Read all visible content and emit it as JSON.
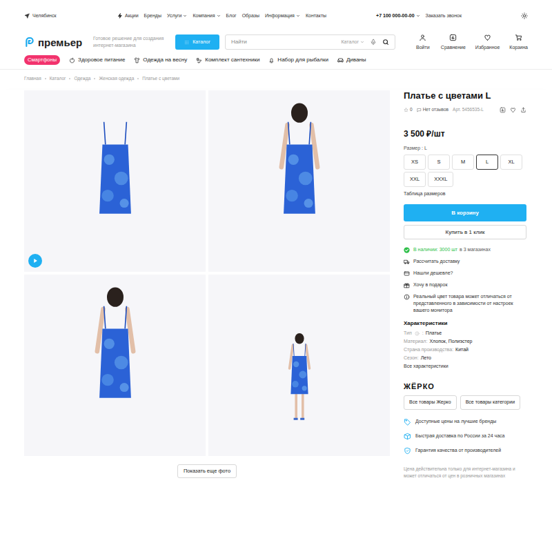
{
  "topbar": {
    "city": "Челябинск",
    "nav": [
      {
        "label": "Акции",
        "dropdown": false
      },
      {
        "label": "Бренды",
        "dropdown": false
      },
      {
        "label": "Услуги",
        "dropdown": true
      },
      {
        "label": "Компания",
        "dropdown": true
      },
      {
        "label": "Блог",
        "dropdown": false
      },
      {
        "label": "Образы",
        "dropdown": false
      },
      {
        "label": "Информация",
        "dropdown": true
      },
      {
        "label": "Контакты",
        "dropdown": false
      }
    ],
    "phone": "+7 100 000-00-00",
    "phone_dropdown": true,
    "callback": "Заказать звонок"
  },
  "header": {
    "logo": "премьер",
    "tagline": "Готовое решение для создания интернет-магазина",
    "catalog_button": "Каталог",
    "search": {
      "placeholder": "Найти",
      "scope": "Каталог"
    },
    "actions": [
      {
        "label": "Войти"
      },
      {
        "label": "Сравнение"
      },
      {
        "label": "Избранное"
      },
      {
        "label": "Корзина"
      }
    ]
  },
  "categories": [
    {
      "label": "Смартфоны",
      "highlighted": true
    },
    {
      "label": "Здоровое питание",
      "highlighted": false
    },
    {
      "label": "Одежда на весну",
      "highlighted": false
    },
    {
      "label": "Комплект сантехники",
      "highlighted": false
    },
    {
      "label": "Набор для рыбалки",
      "highlighted": false
    },
    {
      "label": "Диваны",
      "highlighted": false
    }
  ],
  "breadcrumbs": [
    "Главная",
    "Каталог",
    "Одежда",
    "Женская одежда",
    "Платье с цветами"
  ],
  "gallery": {
    "photos": [
      {
        "video": true
      },
      {
        "video": false
      },
      {
        "video": false
      },
      {
        "video": false
      }
    ],
    "more_button": "Показать еще фото"
  },
  "product": {
    "title": "Платье с цветами L",
    "rating": {
      "stars": 0,
      "count": "0"
    },
    "reviews": "Нет отзывов",
    "sku": "Арт. 5456535-L",
    "price": "3 500 ₽/шт",
    "size_label": "Размер : L",
    "sizes": [
      {
        "label": "XS",
        "selected": false
      },
      {
        "label": "S",
        "selected": false
      },
      {
        "label": "M",
        "selected": false
      },
      {
        "label": "L",
        "selected": true
      },
      {
        "label": "XL",
        "selected": false
      },
      {
        "label": "XXL",
        "selected": false
      },
      {
        "label": "XXXL",
        "selected": false
      }
    ],
    "size_table": "Таблица размеров",
    "cart_button": "В корзину",
    "one_click_button": "Купить в 1 клик",
    "stock": {
      "available": "В наличии: 3000 шт",
      "where": "в 3 магазинах",
      "in_stock": true
    },
    "links": [
      "Рассчитать доставку",
      "Нашли дешевле?",
      "Хочу в подарок",
      "Реальный цвет товара может отличаться от представленного в зависимости от настроек вашего монитора"
    ],
    "specs_title": "Характеристики",
    "specs": [
      {
        "name": "Тип",
        "hint": true,
        "colon": ":",
        "value": "Платье"
      },
      {
        "name": "Материал",
        "hint": false,
        "colon": ":",
        "value": "Хлопок, Полиэстер"
      },
      {
        "name": "Страна производства",
        "hint": false,
        "colon": ":",
        "value": "Китай"
      },
      {
        "name": "Сезон",
        "hint": false,
        "colon": ":",
        "value": "Лето"
      }
    ],
    "all_specs": "Все характеристики",
    "brand": {
      "logo": "ЖЁРКО",
      "buttons": [
        "Все товары Жерко",
        "Все товары категории"
      ]
    },
    "advantages": [
      "Доступные цены на лучшие бренды",
      "Быстрая доставка по России за 24 часа",
      "Гарантия качества от производителей"
    ],
    "note": "Цена действительна только для интернет-магазина и может отличаться от цен в розничных магазинах"
  }
}
